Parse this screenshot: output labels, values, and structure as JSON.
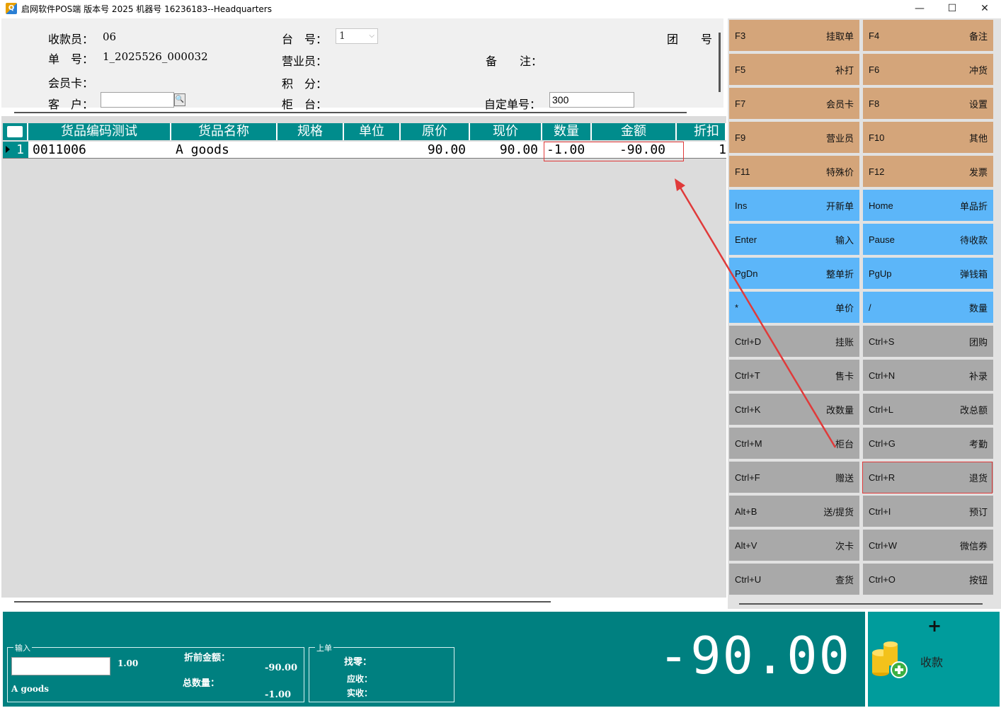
{
  "window": {
    "title": "启网软件POS端 版本号 2025 机器号 16236183--Headquarters",
    "minimize": "—",
    "maximize": "☐",
    "close": "✕"
  },
  "header": {
    "cashier_label": "收款员：",
    "cashier_value": "06",
    "order_no_label": "单　号：",
    "order_no_value": "1_2025526_000032",
    "member_card_label": "会员卡：",
    "customer_label": "客　户：",
    "customer_value": "",
    "station_label": "台　号：",
    "station_value": "1",
    "salesperson_label": "营业员：",
    "points_label": "积　分：",
    "counter_label": "柜　台：",
    "group_label": "团　　号",
    "remark_label": "备　　注：",
    "custom_order_label": "自定单号：",
    "custom_order_value": "300"
  },
  "grid": {
    "columns": [
      "货品编码测试",
      "货品名称",
      "规格",
      "单位",
      "原价",
      "现价",
      "数量",
      "金额",
      "折扣"
    ],
    "rows": [
      {
        "num": "1",
        "code": "0011006",
        "name": "A goods",
        "spec": "",
        "unit": "",
        "orig_price": "90.00",
        "cur_price": "90.00",
        "qty": "-1.00",
        "amount": "-90.00",
        "discount": "1"
      }
    ]
  },
  "function_keys": [
    {
      "key": "F3",
      "label": "挂取单",
      "color": "tan"
    },
    {
      "key": "F4",
      "label": "备注",
      "color": "tan"
    },
    {
      "key": "F5",
      "label": "补打",
      "color": "tan"
    },
    {
      "key": "F6",
      "label": "冲货",
      "color": "tan"
    },
    {
      "key": "F7",
      "label": "会员卡",
      "color": "tan"
    },
    {
      "key": "F8",
      "label": "设置",
      "color": "tan"
    },
    {
      "key": "F9",
      "label": "营业员",
      "color": "tan"
    },
    {
      "key": "F10",
      "label": "其他",
      "color": "tan"
    },
    {
      "key": "F11",
      "label": "特殊价",
      "color": "tan"
    },
    {
      "key": "F12",
      "label": "发票",
      "color": "tan"
    },
    {
      "key": "Ins",
      "label": "开新单",
      "color": "blue"
    },
    {
      "key": "Home",
      "label": "单品折",
      "color": "blue"
    },
    {
      "key": "Enter",
      "label": "输入",
      "color": "blue"
    },
    {
      "key": "Pause",
      "label": "待收款",
      "color": "blue"
    },
    {
      "key": "PgDn",
      "label": "整单折",
      "color": "blue"
    },
    {
      "key": "PgUp",
      "label": "弹钱箱",
      "color": "blue"
    },
    {
      "key": "*",
      "label": "单价",
      "color": "blue"
    },
    {
      "key": "/",
      "label": "数量",
      "color": "blue"
    },
    {
      "key": "Ctrl+D",
      "label": "挂账",
      "color": "gray"
    },
    {
      "key": "Ctrl+S",
      "label": "团购",
      "color": "gray"
    },
    {
      "key": "Ctrl+T",
      "label": "售卡",
      "color": "gray"
    },
    {
      "key": "Ctrl+N",
      "label": "补录",
      "color": "gray"
    },
    {
      "key": "Ctrl+K",
      "label": "改数量",
      "color": "gray"
    },
    {
      "key": "Ctrl+L",
      "label": "改总额",
      "color": "gray"
    },
    {
      "key": "Ctrl+M",
      "label": "柜台",
      "color": "gray"
    },
    {
      "key": "Ctrl+G",
      "label": "考勤",
      "color": "gray"
    },
    {
      "key": "Ctrl+F",
      "label": "赠送",
      "color": "gray"
    },
    {
      "key": "Ctrl+R",
      "label": "退货",
      "color": "gray"
    },
    {
      "key": "Alt+B",
      "label": "送/提货",
      "color": "gray"
    },
    {
      "key": "Ctrl+I",
      "label": "预订",
      "color": "gray"
    },
    {
      "key": "Alt+V",
      "label": "次卡",
      "color": "gray"
    },
    {
      "key": "Ctrl+W",
      "label": "微信券",
      "color": "gray"
    },
    {
      "key": "Ctrl+U",
      "label": "查货",
      "color": "gray"
    },
    {
      "key": "Ctrl+O",
      "label": "按钮",
      "color": "gray"
    }
  ],
  "bottom": {
    "input_group_label": "输入",
    "input_qty": "1.00",
    "item_name": "A goods",
    "pre_discount_label": "折前金额：",
    "pre_discount_value": "-90.00",
    "total_qty_label": "总数量：",
    "total_qty_value": "-1.00",
    "prev_group_label": "上单",
    "change_label": "找零：",
    "receivable_label": "应收：",
    "received_label": "实收：",
    "big_total": "-90.00",
    "pay_plus": "+",
    "pay_label": "收款"
  },
  "colors": {
    "teal": "#008080",
    "tan_key": "#d4a57a",
    "blue_key": "#5cb6f9",
    "gray_key": "#a9a9a9",
    "annotation_red": "#e03a3a"
  }
}
